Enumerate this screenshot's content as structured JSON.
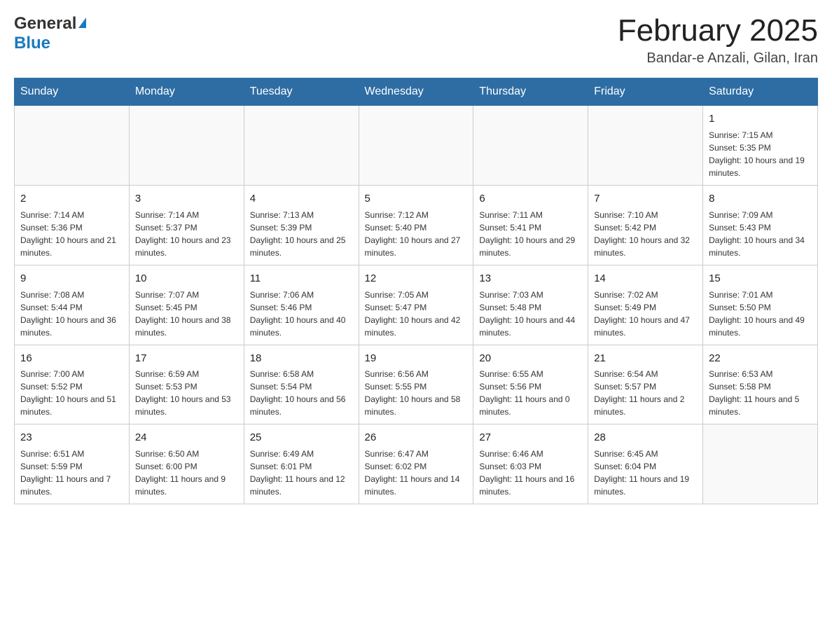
{
  "logo": {
    "general": "General",
    "blue": "Blue"
  },
  "title": "February 2025",
  "location": "Bandar-e Anzali, Gilan, Iran",
  "days_of_week": [
    "Sunday",
    "Monday",
    "Tuesday",
    "Wednesday",
    "Thursday",
    "Friday",
    "Saturday"
  ],
  "weeks": [
    [
      {
        "day": "",
        "info": ""
      },
      {
        "day": "",
        "info": ""
      },
      {
        "day": "",
        "info": ""
      },
      {
        "day": "",
        "info": ""
      },
      {
        "day": "",
        "info": ""
      },
      {
        "day": "",
        "info": ""
      },
      {
        "day": "1",
        "info": "Sunrise: 7:15 AM\nSunset: 5:35 PM\nDaylight: 10 hours and 19 minutes."
      }
    ],
    [
      {
        "day": "2",
        "info": "Sunrise: 7:14 AM\nSunset: 5:36 PM\nDaylight: 10 hours and 21 minutes."
      },
      {
        "day": "3",
        "info": "Sunrise: 7:14 AM\nSunset: 5:37 PM\nDaylight: 10 hours and 23 minutes."
      },
      {
        "day": "4",
        "info": "Sunrise: 7:13 AM\nSunset: 5:39 PM\nDaylight: 10 hours and 25 minutes."
      },
      {
        "day": "5",
        "info": "Sunrise: 7:12 AM\nSunset: 5:40 PM\nDaylight: 10 hours and 27 minutes."
      },
      {
        "day": "6",
        "info": "Sunrise: 7:11 AM\nSunset: 5:41 PM\nDaylight: 10 hours and 29 minutes."
      },
      {
        "day": "7",
        "info": "Sunrise: 7:10 AM\nSunset: 5:42 PM\nDaylight: 10 hours and 32 minutes."
      },
      {
        "day": "8",
        "info": "Sunrise: 7:09 AM\nSunset: 5:43 PM\nDaylight: 10 hours and 34 minutes."
      }
    ],
    [
      {
        "day": "9",
        "info": "Sunrise: 7:08 AM\nSunset: 5:44 PM\nDaylight: 10 hours and 36 minutes."
      },
      {
        "day": "10",
        "info": "Sunrise: 7:07 AM\nSunset: 5:45 PM\nDaylight: 10 hours and 38 minutes."
      },
      {
        "day": "11",
        "info": "Sunrise: 7:06 AM\nSunset: 5:46 PM\nDaylight: 10 hours and 40 minutes."
      },
      {
        "day": "12",
        "info": "Sunrise: 7:05 AM\nSunset: 5:47 PM\nDaylight: 10 hours and 42 minutes."
      },
      {
        "day": "13",
        "info": "Sunrise: 7:03 AM\nSunset: 5:48 PM\nDaylight: 10 hours and 44 minutes."
      },
      {
        "day": "14",
        "info": "Sunrise: 7:02 AM\nSunset: 5:49 PM\nDaylight: 10 hours and 47 minutes."
      },
      {
        "day": "15",
        "info": "Sunrise: 7:01 AM\nSunset: 5:50 PM\nDaylight: 10 hours and 49 minutes."
      }
    ],
    [
      {
        "day": "16",
        "info": "Sunrise: 7:00 AM\nSunset: 5:52 PM\nDaylight: 10 hours and 51 minutes."
      },
      {
        "day": "17",
        "info": "Sunrise: 6:59 AM\nSunset: 5:53 PM\nDaylight: 10 hours and 53 minutes."
      },
      {
        "day": "18",
        "info": "Sunrise: 6:58 AM\nSunset: 5:54 PM\nDaylight: 10 hours and 56 minutes."
      },
      {
        "day": "19",
        "info": "Sunrise: 6:56 AM\nSunset: 5:55 PM\nDaylight: 10 hours and 58 minutes."
      },
      {
        "day": "20",
        "info": "Sunrise: 6:55 AM\nSunset: 5:56 PM\nDaylight: 11 hours and 0 minutes."
      },
      {
        "day": "21",
        "info": "Sunrise: 6:54 AM\nSunset: 5:57 PM\nDaylight: 11 hours and 2 minutes."
      },
      {
        "day": "22",
        "info": "Sunrise: 6:53 AM\nSunset: 5:58 PM\nDaylight: 11 hours and 5 minutes."
      }
    ],
    [
      {
        "day": "23",
        "info": "Sunrise: 6:51 AM\nSunset: 5:59 PM\nDaylight: 11 hours and 7 minutes."
      },
      {
        "day": "24",
        "info": "Sunrise: 6:50 AM\nSunset: 6:00 PM\nDaylight: 11 hours and 9 minutes."
      },
      {
        "day": "25",
        "info": "Sunrise: 6:49 AM\nSunset: 6:01 PM\nDaylight: 11 hours and 12 minutes."
      },
      {
        "day": "26",
        "info": "Sunrise: 6:47 AM\nSunset: 6:02 PM\nDaylight: 11 hours and 14 minutes."
      },
      {
        "day": "27",
        "info": "Sunrise: 6:46 AM\nSunset: 6:03 PM\nDaylight: 11 hours and 16 minutes."
      },
      {
        "day": "28",
        "info": "Sunrise: 6:45 AM\nSunset: 6:04 PM\nDaylight: 11 hours and 19 minutes."
      },
      {
        "day": "",
        "info": ""
      }
    ]
  ]
}
